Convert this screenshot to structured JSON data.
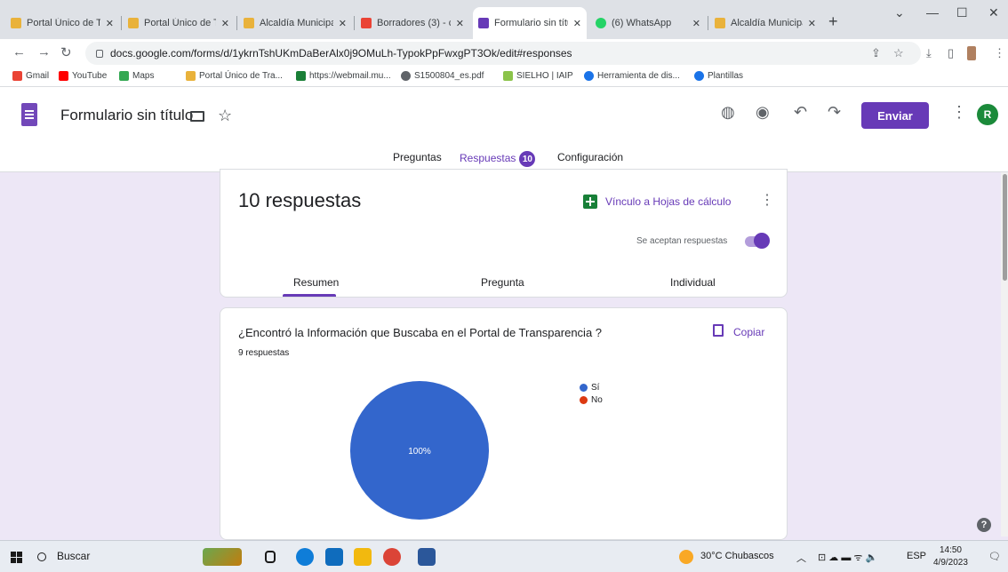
{
  "browser": {
    "tabs": [
      {
        "label": "Portal Único de T",
        "close": "✕"
      },
      {
        "label": "Portal Único de T",
        "close": "✕"
      },
      {
        "label": "Alcaldía Municipa",
        "close": "✕"
      },
      {
        "label": "Borradores (3) - c",
        "close": "✕"
      },
      {
        "label": "Formulario sin títu",
        "close": "✕"
      },
      {
        "label": "(6) WhatsApp",
        "close": "✕"
      },
      {
        "label": "Alcaldía Municipa",
        "close": "✕"
      }
    ],
    "new_tab": "+",
    "url": "docs.google.com/forms/d/1ykrnTshUKmDaBerAlx0j9OMuLh-TypokPpFwxgPT3Ok/edit#responses",
    "bookmarks": [
      "Gmail",
      "YouTube",
      "Maps",
      "Portal Único de Tra...",
      "https://webmail.mu...",
      "S1500804_es.pdf",
      "SIELHO | IAIP",
      "Herramienta de dis...",
      "Plantillas"
    ]
  },
  "forms": {
    "title": "Formulario sin título",
    "send_label": "Enviar",
    "avatar_letter": "R",
    "tabs": {
      "questions": "Preguntas",
      "responses": "Respuestas",
      "responses_count": "10",
      "settings": "Configuración"
    }
  },
  "summary_card": {
    "title": "10 respuestas",
    "sheets_link": "Vínculo a Hojas de cálculo",
    "accepting_label": "Se aceptan respuestas",
    "subtabs": [
      "Resumen",
      "Pregunta",
      "Individual"
    ]
  },
  "question_card": {
    "question": "¿Encontró la Información que Buscaba en el Portal de Transparencia ?",
    "response_count": "9 respuestas",
    "copy_label": "Copiar"
  },
  "chart_data": {
    "type": "pie",
    "categories": [
      "Sí",
      "No"
    ],
    "values": [
      100,
      0
    ],
    "data_labels": [
      "100%"
    ],
    "colors": [
      "#3366cc",
      "#dc3912"
    ],
    "legend_position": "right"
  },
  "taskbar": {
    "search_label": "Buscar",
    "weather": "30°C  Chubascos",
    "lang": "ESP",
    "time": "14:50",
    "date": "4/9/2023"
  }
}
